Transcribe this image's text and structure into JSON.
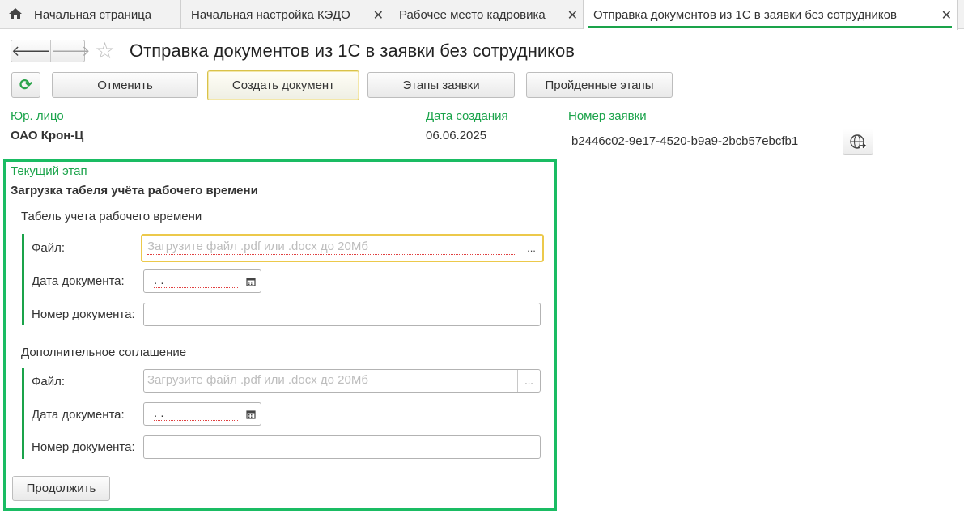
{
  "tabs": [
    {
      "label": "Начальная страница",
      "icon": "home-icon"
    },
    {
      "label": "Начальная настройка КЭДО",
      "close": "✕"
    },
    {
      "label": "Рабочее место кадровика",
      "close": "✕"
    },
    {
      "label": "Отправка документов из 1С в заявки без сотрудников",
      "close": "✕"
    }
  ],
  "nav": {
    "back": "🡐",
    "forward": "🡒",
    "star": "☆"
  },
  "page_title": "Отправка документов из 1С в заявки без сотрудников",
  "toolbar": {
    "refresh": "⟳",
    "cancel": "Отменить",
    "create_document": "Создать документ",
    "request_stages": "Этапы заявки",
    "passed_stages": "Пройденные этапы"
  },
  "header": {
    "legal_entity_label": "Юр. лицо",
    "legal_entity_value": "ОАО Крон-Ц",
    "created_label": "Дата создания",
    "created_value": "06.06.2025",
    "request_number_label": "Номер заявки",
    "request_number_value": "b2446c02-9e17-4520-b9a9-2bcb57ebcfb1"
  },
  "stage": {
    "label": "Текущий этап",
    "name": "Загрузка табеля учёта рабочего времени",
    "groups": [
      {
        "title": "Табель учета рабочего времени",
        "file_label": "Файл:",
        "file_placeholder": "Загрузите файл .pdf или .docx до 20Мб",
        "file_pick": "...",
        "date_label": "Дата документа:",
        "date_value": " .  .",
        "number_label": "Номер документа:",
        "number_value": ""
      },
      {
        "title": "Дополнительное соглашение",
        "file_label": "Файл:",
        "file_placeholder": "Загрузите файл .pdf или .docx до 20Мб",
        "file_pick": "...",
        "date_label": "Дата документа:",
        "date_value": " .  .",
        "number_label": "Номер документа:",
        "number_value": ""
      }
    ],
    "continue": "Продолжить"
  },
  "colors": {
    "accent": "#1aa34a",
    "frame": "#1abc63",
    "focus": "#ecc94b"
  }
}
